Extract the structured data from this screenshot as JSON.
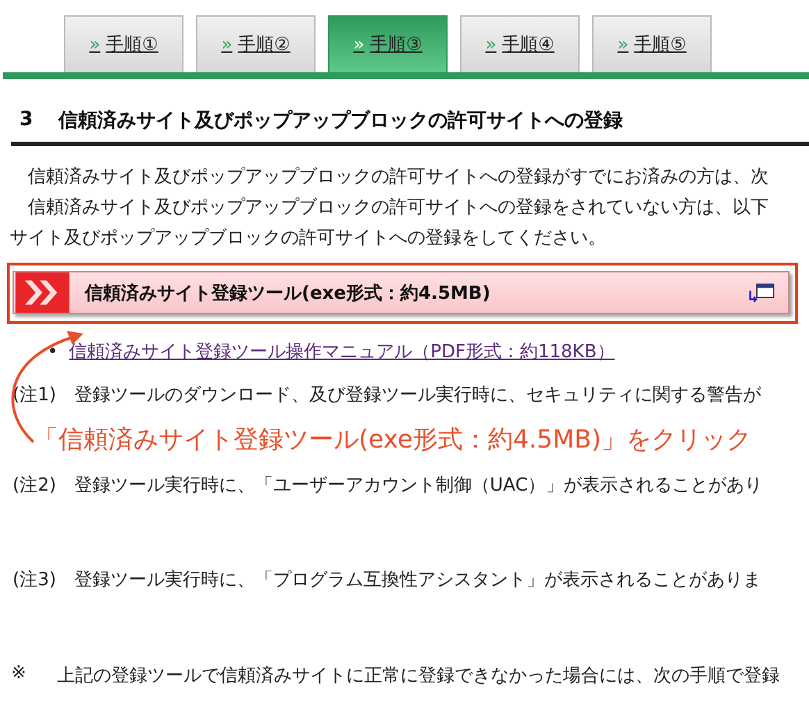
{
  "tabs": [
    {
      "marker": "»",
      "label": "手順①",
      "selected": false
    },
    {
      "marker": "»",
      "label": "手順②",
      "selected": false
    },
    {
      "marker": "»",
      "label": "手順③",
      "selected": true
    },
    {
      "marker": "»",
      "label": "手順④",
      "selected": false
    },
    {
      "marker": "»",
      "label": "手順⑤",
      "selected": false
    }
  ],
  "section": {
    "number": "3",
    "title": "信頼済みサイト及びポップアップブロックの許可サイトへの登録"
  },
  "intro_lines": [
    "　信頼済みサイト及びポップアップブロックの許可サイトへの登録がすでにお済みの方は、次",
    "　信頼済みサイト及びポップアップブロックの許可サイトへの登録をされていない方は、以下",
    "サイト及びポップアップブロックの許可サイトへの登録をしてください。"
  ],
  "download_button": {
    "label": "信頼済みサイト登録ツール(exe形式：約4.5MB)"
  },
  "links": [
    {
      "bullet": "•",
      "text": "信頼済みサイト登録ツール操作マニュアル（PDF形式：約118KB）"
    }
  ],
  "notes": [
    {
      "label": "(注1)",
      "text": "登録ツールのダウンロード、及び登録ツール実行時に、セキュリティに関する警告が"
    },
    {
      "label": "(注2)",
      "text": "登録ツール実行時に、「ユーザーアカウント制御（UAC）」が表示されることがあり"
    },
    {
      "label": "(注3)",
      "text": "登録ツール実行時に、「プログラム互換性アシスタント」が表示されることがありま"
    }
  ],
  "annotation": "「信頼済みサイト登録ツール(exe形式：約4.5MB)」をクリック",
  "footnote": {
    "mark": "※",
    "text": "上記の登録ツールで信頼済みサイトに正常に登録できなかった場合には、次の手順で登録"
  }
}
